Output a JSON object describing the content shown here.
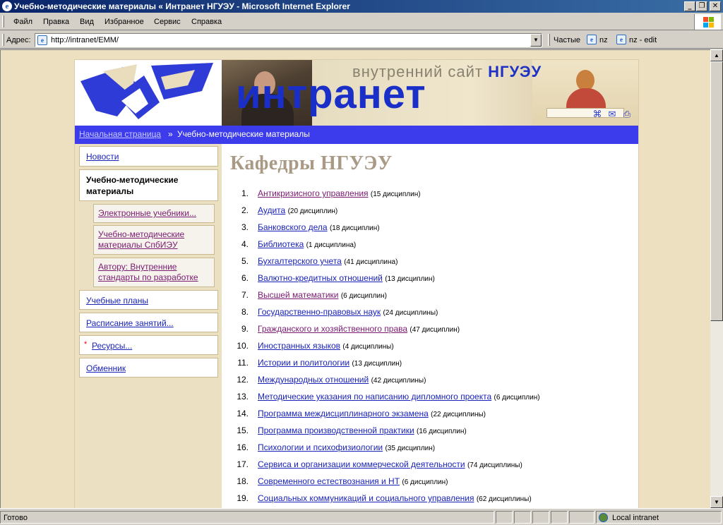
{
  "window": {
    "title": "Учебно-методические материалы « Интранет НГУЭУ - Microsoft Internet Explorer",
    "minimize_glyph": "_",
    "maximize_glyph": "❐",
    "close_glyph": "✕"
  },
  "menu": {
    "items": [
      "Файл",
      "Правка",
      "Вид",
      "Избранное",
      "Сервис",
      "Справка"
    ]
  },
  "address": {
    "label": "Адрес:",
    "url": "http://intranet/EMM/",
    "links_label": "Частые",
    "links": [
      "nz",
      "nz - edit"
    ]
  },
  "banner": {
    "tagline_prefix": "внутренний сайт",
    "tagline_brand": "НГУЭУ",
    "big_word": "интранет",
    "icons": [
      "sitemap-icon",
      "mail-icon",
      "print-icon"
    ]
  },
  "breadcrumb": {
    "home": "Начальная страница",
    "separator": "»",
    "current": "Учебно-методические материалы"
  },
  "sidebar": {
    "news": "Новости",
    "active": "Учебно-методические материалы",
    "sub": [
      "Электронные учебники...",
      "Учебно-методические материалы СпбИЭУ",
      "Автору: Внутренние стандарты по разработке"
    ],
    "plans": "Учебные планы",
    "schedule": "Расписание занятий...",
    "resources": "Ресурсы...",
    "exchange": "Обменник",
    "star": "*"
  },
  "content": {
    "heading": "Кафедры НГУЭУ",
    "departments": [
      {
        "num": "1.",
        "name": "Антикризисного управления",
        "count": "(15 дисциплин)",
        "visited": true
      },
      {
        "num": "2.",
        "name": "Аудита",
        "count": "(20 дисциплин)",
        "visited": false
      },
      {
        "num": "3.",
        "name": "Банковского дела",
        "count": "(18 дисциплин)",
        "visited": false
      },
      {
        "num": "4.",
        "name": "Библиотека",
        "count": "(1 дисциплина)",
        "visited": false
      },
      {
        "num": "5.",
        "name": "Бухгалтерского учета",
        "count": "(41 дисциплина)",
        "visited": false
      },
      {
        "num": "6.",
        "name": "Валютно-кредитных отношений",
        "count": "(13 дисциплин)",
        "visited": false
      },
      {
        "num": "7.",
        "name": "Высшей математики",
        "count": "(6 дисциплин)",
        "visited": true
      },
      {
        "num": "8.",
        "name": "Государственно-правовых наук",
        "count": "(24 дисциплины)",
        "visited": false
      },
      {
        "num": "9.",
        "name": "Гражданского и хозяйственного права",
        "count": "(47 дисциплин)",
        "visited": true
      },
      {
        "num": "10.",
        "name": "Иностранных языков",
        "count": "(4 дисциплины)",
        "visited": false
      },
      {
        "num": "11.",
        "name": "Истории и политологии",
        "count": "(13 дисциплин)",
        "visited": false
      },
      {
        "num": "12.",
        "name": "Международных отношений",
        "count": "(42 дисциплины)",
        "visited": false
      },
      {
        "num": "13.",
        "name": "Методические указания по написанию дипломного проекта",
        "count": "(6 дисциплин)",
        "visited": false
      },
      {
        "num": "14.",
        "name": "Программа междисциплинарного экзамена",
        "count": "(22 дисциплины)",
        "visited": false
      },
      {
        "num": "15.",
        "name": "Программа производственной практики",
        "count": "(16 дисциплин)",
        "visited": false
      },
      {
        "num": "16.",
        "name": "Психологии и психофизиологии",
        "count": "(35 дисциплин)",
        "visited": false
      },
      {
        "num": "17.",
        "name": "Сервиса и организации коммерческой деятельности",
        "count": "(74 дисциплины)",
        "visited": false
      },
      {
        "num": "18.",
        "name": "Современного естествознания и НТ",
        "count": "(6 дисциплин)",
        "visited": false
      },
      {
        "num": "19.",
        "name": "Социальных коммуникаций и социального управления",
        "count": "(62 дисциплины)",
        "visited": false
      }
    ]
  },
  "status": {
    "left": "Готово",
    "zone": "Local intranet"
  },
  "colors": {
    "accent": "#3c3ced",
    "page_bg": "#ece0c0",
    "link": "#1a23b8",
    "visited": "#7a1a70",
    "heading": "#a89a84"
  }
}
